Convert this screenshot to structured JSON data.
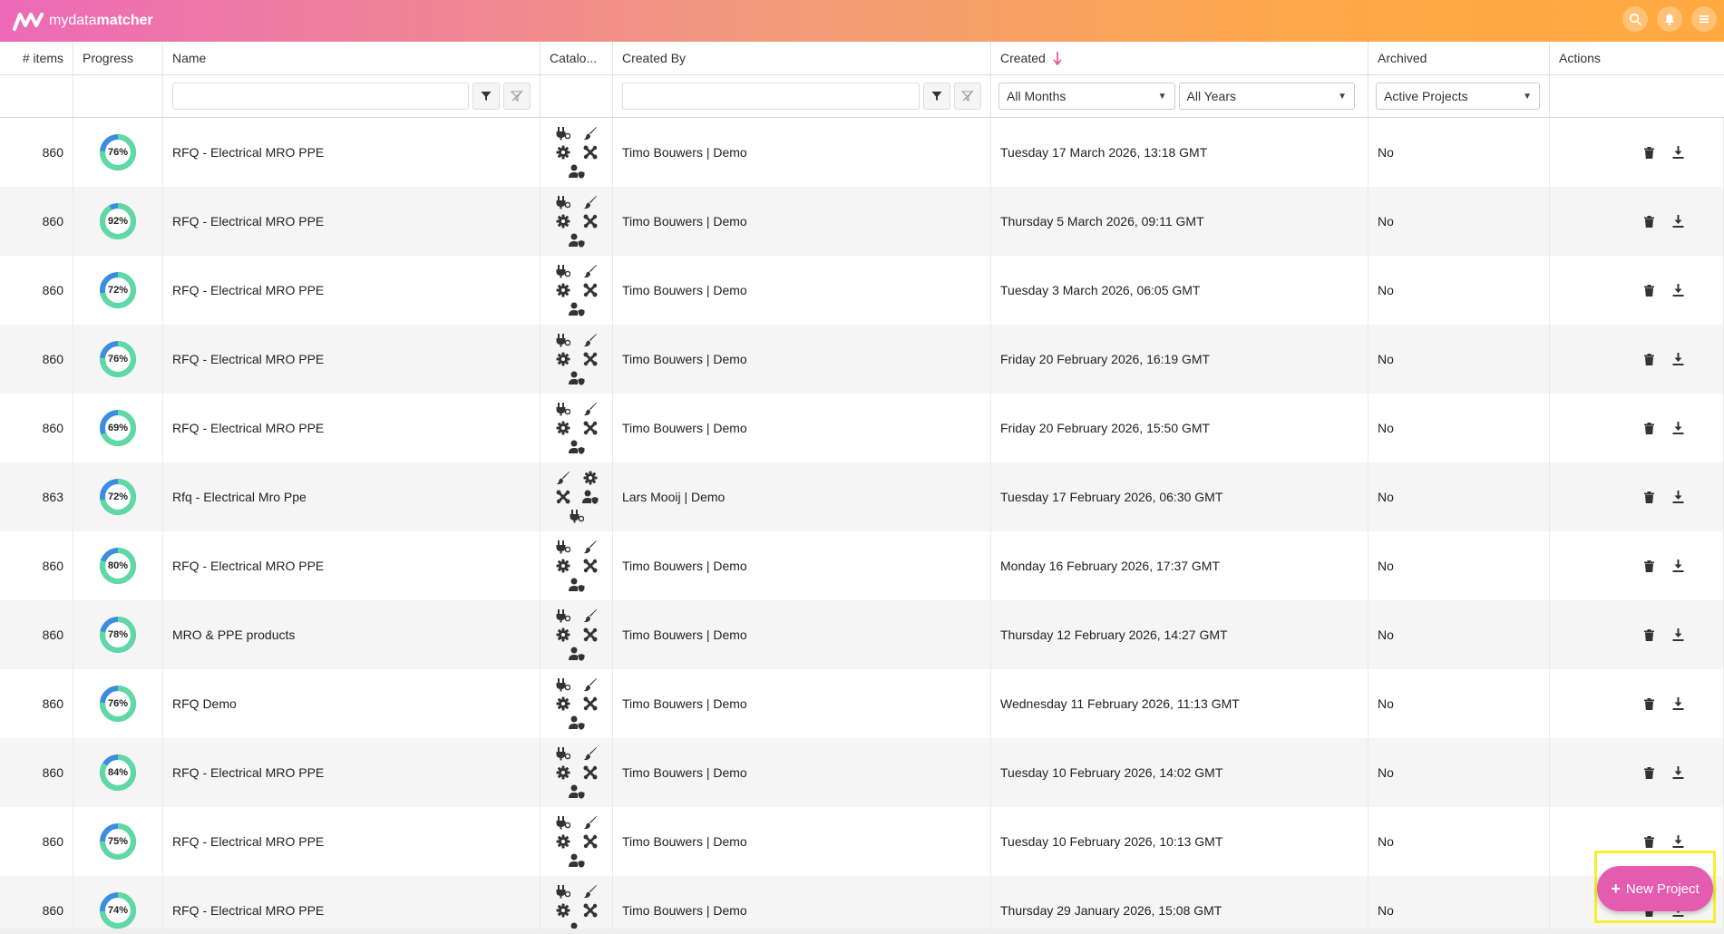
{
  "app": {
    "logo_bold": "mydata",
    "logo_rest": "matcher"
  },
  "header_icons": [
    "search-icon",
    "bell-icon",
    "menu-icon"
  ],
  "columns": {
    "items": "# items",
    "progress": "Progress",
    "name": "Name",
    "catalog": "Catalo...",
    "created_by": "Created By",
    "created": "Created",
    "archived": "Archived",
    "actions": "Actions"
  },
  "filters": {
    "name_value": "",
    "created_by_value": "",
    "months": "All Months",
    "years": "All Years",
    "archived": "Active Projects"
  },
  "colors": {
    "accent": "#e8489a",
    "donut_green": "#5fd9a3",
    "donut_blue": "#3a8de0",
    "fab": "#e45cb0"
  },
  "rows": [
    {
      "items": "860",
      "progress": 76,
      "progress_label": "76%",
      "name": "RFQ - Electrical MRO PPE",
      "created_by": "Timo Bouwers | Demo",
      "created": "Tuesday 17 March 2026, 13:18 GMT",
      "archived": "No",
      "alt_icons": false
    },
    {
      "items": "860",
      "progress": 92,
      "progress_label": "92%",
      "name": "RFQ - Electrical MRO PPE",
      "created_by": "Timo Bouwers | Demo",
      "created": "Thursday 5 March 2026, 09:11 GMT",
      "archived": "No",
      "alt_icons": false
    },
    {
      "items": "860",
      "progress": 72,
      "progress_label": "72%",
      "name": "RFQ - Electrical MRO PPE",
      "created_by": "Timo Bouwers | Demo",
      "created": "Tuesday 3 March 2026, 06:05 GMT",
      "archived": "No",
      "alt_icons": false
    },
    {
      "items": "860",
      "progress": 76,
      "progress_label": "76%",
      "name": "RFQ - Electrical MRO PPE",
      "created_by": "Timo Bouwers | Demo",
      "created": "Friday 20 February 2026, 16:19 GMT",
      "archived": "No",
      "alt_icons": false
    },
    {
      "items": "860",
      "progress": 69,
      "progress_label": "69%",
      "name": "RFQ - Electrical MRO PPE",
      "created_by": "Timo Bouwers | Demo",
      "created": "Friday 20 February 2026, 15:50 GMT",
      "archived": "No",
      "alt_icons": false
    },
    {
      "items": "863",
      "progress": 72,
      "progress_label": "72%",
      "name": "Rfq - Electrical Mro Ppe",
      "created_by": "Lars Mooij | Demo",
      "created": "Tuesday 17 February 2026, 06:30 GMT",
      "archived": "No",
      "alt_icons": true
    },
    {
      "items": "860",
      "progress": 80,
      "progress_label": "80%",
      "name": "RFQ - Electrical MRO PPE",
      "created_by": "Timo Bouwers | Demo",
      "created": "Monday 16 February 2026, 17:37 GMT",
      "archived": "No",
      "alt_icons": false
    },
    {
      "items": "860",
      "progress": 78,
      "progress_label": "78%",
      "name": "MRO & PPE products",
      "created_by": "Timo Bouwers | Demo",
      "created": "Thursday 12 February 2026, 14:27 GMT",
      "archived": "No",
      "alt_icons": false
    },
    {
      "items": "860",
      "progress": 76,
      "progress_label": "76%",
      "name": "RFQ Demo",
      "created_by": "Timo Bouwers | Demo",
      "created": "Wednesday 11 February 2026, 11:13 GMT",
      "archived": "No",
      "alt_icons": false
    },
    {
      "items": "860",
      "progress": 84,
      "progress_label": "84%",
      "name": "RFQ - Electrical MRO PPE",
      "created_by": "Timo Bouwers | Demo",
      "created": "Tuesday 10 February 2026, 14:02 GMT",
      "archived": "No",
      "alt_icons": false
    },
    {
      "items": "860",
      "progress": 75,
      "progress_label": "75%",
      "name": "RFQ - Electrical MRO PPE",
      "created_by": "Timo Bouwers | Demo",
      "created": "Tuesday 10 February 2026, 10:13 GMT",
      "archived": "No",
      "alt_icons": false
    },
    {
      "items": "860",
      "progress": 74,
      "progress_label": "74%",
      "name": "RFQ - Electrical MRO PPE",
      "created_by": "Timo Bouwers | Demo",
      "created": "Thursday 29 January 2026, 15:08 GMT",
      "archived": "No",
      "alt_icons": false
    }
  ],
  "fab": {
    "label": "New Project"
  }
}
